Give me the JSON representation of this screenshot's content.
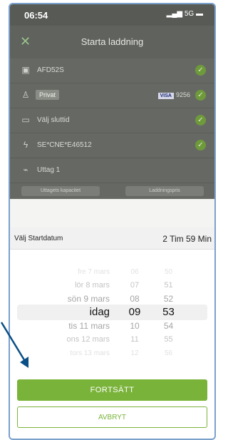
{
  "status_bar": {
    "time": "06:54",
    "network": "5G"
  },
  "nav": {
    "title": "Starta laddning"
  },
  "rows": [
    {
      "label": "AFD52S"
    },
    {
      "label": "Privat",
      "card_brand": "VISA",
      "card_number": "9256"
    },
    {
      "label": "Välj sluttid"
    },
    {
      "label": "SE*CNE*E46512"
    },
    {
      "label": "Uttag 1"
    }
  ],
  "tabs": [
    "Uttagets kapacitet",
    "Laddningspris"
  ],
  "sheet": {
    "title": "Välj Startdatum",
    "duration": "2 Tim 59 Min"
  },
  "picker": {
    "dates": [
      "fre 7 mars",
      "lör 8 mars",
      "sön 9 mars",
      "idag",
      "tis 11 mars",
      "ons 12 mars",
      "tors 13 mars"
    ],
    "hours": [
      "06",
      "07",
      "08",
      "09",
      "10",
      "11",
      "12"
    ],
    "minutes": [
      "50",
      "51",
      "52",
      "53",
      "54",
      "55",
      "56"
    ],
    "selected_index": 3
  },
  "buttons": {
    "continue": "FORTSÄTT",
    "cancel": "AVBRYT"
  }
}
